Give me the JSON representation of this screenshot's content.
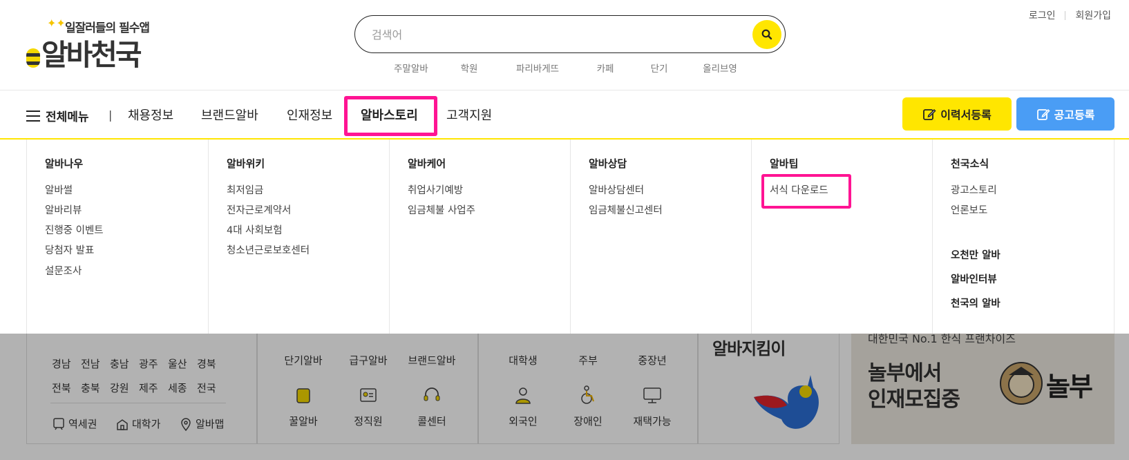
{
  "header": {
    "logo_tagline": "일잘러들의 필수앱",
    "logo_brand": "알바천국",
    "search_placeholder": "검색어",
    "popular_keywords": [
      "주말알바",
      "학원",
      "파리바게뜨",
      "카페",
      "단기",
      "올리브영"
    ],
    "login": "로그인",
    "signup": "회원가입"
  },
  "nav": {
    "menu_all": "전체메뉴",
    "separator": "|",
    "items": [
      "채용정보",
      "브랜드알바",
      "인재정보",
      "알바스토리",
      "고객지원"
    ],
    "active_index": 3,
    "resume_button": "이력서등록",
    "post_button": "공고등록",
    "accent_color": "#ffe600",
    "highlight_color": "#ff1493",
    "post_color": "#4a9df5"
  },
  "dropdown": {
    "columns": [
      {
        "title": "알바나우",
        "links": [
          "알바썰",
          "알바리뷰",
          "진행중 이벤트",
          "당첨자 발표",
          "설문조사"
        ]
      },
      {
        "title": "알바위키",
        "links": [
          "최저임금",
          "전자근로계약서",
          "4대 사회보험",
          "청소년근로보호센터"
        ]
      },
      {
        "title": "알바케어",
        "links": [
          "취업사기예방",
          "임금체불 사업주"
        ]
      },
      {
        "title": "알바상담",
        "links": [
          "알바상담센터",
          "임금체불신고센터"
        ]
      },
      {
        "title": "알바팁",
        "links": [
          "서식 다운로드"
        ]
      },
      {
        "title": "천국소식",
        "links": [
          "광고스토리",
          "언론보도"
        ],
        "bold_links": [
          "오천만 알바",
          "알바인터뷰",
          "천국의 알바"
        ]
      }
    ]
  },
  "background": {
    "regions_row1": [
      "경남",
      "전남",
      "충남",
      "광주",
      "울산",
      "경북"
    ],
    "regions_row2": [
      "전북",
      "충북",
      "강원",
      "제주",
      "세종",
      "전국"
    ],
    "region_links": [
      "역세권",
      "대학가",
      "알바맵"
    ],
    "cats_row1": [
      "단기알바",
      "급구알바",
      "브랜드알바"
    ],
    "cats_row2": [
      "꿀알바",
      "정직원",
      "콜센터"
    ],
    "people_row1": [
      "대학생",
      "주부",
      "중장년"
    ],
    "people_row2": [
      "외국인",
      "장애인",
      "재택가능"
    ],
    "banner1_text": "알바지킴이",
    "banner2_top": "대한민국 No.1 한식 프랜차이즈",
    "banner2_title_1": "놀부에서",
    "banner2_title_2": "인재모집중",
    "banner2_brand": "놀부"
  }
}
